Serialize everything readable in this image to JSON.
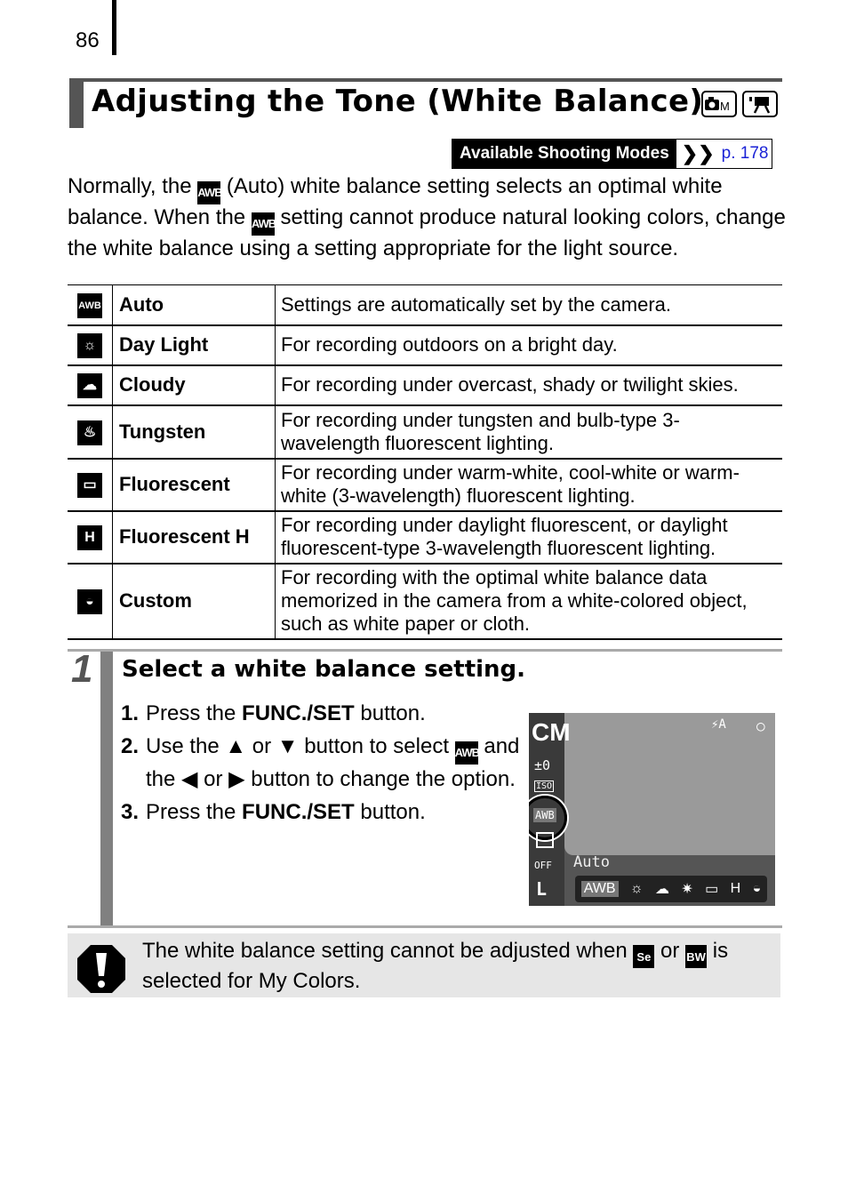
{
  "page_number": "86",
  "heading": {
    "title": "Adjusting the Tone (White Balance)",
    "mode_icons": [
      "camera-m-mode-icon",
      "movie-mode-icon"
    ],
    "mode_icon_text": "M"
  },
  "shooting_modes": {
    "label": "Available Shooting Modes",
    "link_chevron": "❯❯",
    "link_text": "p. 178"
  },
  "intro": {
    "part1": "Normally, the ",
    "icon_label": "AWB",
    "part2": " (Auto) white balance setting selects an optimal white balance. When the ",
    "part3": " setting cannot produce natural looking colors, change the white balance using a setting appropriate for the light source."
  },
  "settings_table": [
    {
      "icon": "awb-icon",
      "glyph": "AWB",
      "name": "Auto",
      "description": "Settings are automatically set by the camera."
    },
    {
      "icon": "daylight-icon",
      "glyph": "☼",
      "name": "Day Light",
      "description": "For recording outdoors on a bright day."
    },
    {
      "icon": "cloudy-icon",
      "glyph": "☁",
      "name": "Cloudy",
      "description": "For recording under overcast, shady or twilight skies."
    },
    {
      "icon": "tungsten-icon",
      "glyph": "♨",
      "name": "Tungsten",
      "description": "For recording under tungsten and bulb-type 3-wavelength fluorescent lighting."
    },
    {
      "icon": "fluorescent-icon",
      "glyph": "▭",
      "name": "Fluorescent",
      "description": "For recording under warm-white, cool-white or warm-white (3-wavelength) fluorescent lighting."
    },
    {
      "icon": "fluorescent-h-icon",
      "glyph": "H",
      "name": "Fluorescent H",
      "description": "For recording under daylight fluorescent, or daylight fluorescent-type 3-wavelength fluorescent lighting."
    },
    {
      "icon": "custom-icon",
      "glyph": "◒",
      "name": "Custom",
      "description": "For recording with the optimal white balance data memorized in the camera from a white-colored object, such as white paper or cloth."
    }
  ],
  "step": {
    "number": "1",
    "title": "Select a white balance setting.",
    "substeps": [
      {
        "n": "1.",
        "pre": "Press the ",
        "bold": "FUNC./SET",
        "post": " button."
      },
      {
        "n": "2.",
        "text_a": "Use the ▲ or ▼ button to select ",
        "icon": "AWB",
        "text_b": " and the ◀ or ▶ button to change the option."
      },
      {
        "n": "3.",
        "pre": "Press the ",
        "bold": "FUNC./SET",
        "post": " button."
      }
    ]
  },
  "camera_screen": {
    "mode": "CM",
    "exposure": "±0",
    "iso": "ISO",
    "wb_selected": "AWB",
    "flash": "⚡A",
    "setting_label": "Auto",
    "options": [
      "AWB",
      "☼",
      "☁",
      "✷",
      "▭",
      "H",
      "◒"
    ],
    "bottom_items": [
      "OFF",
      "L"
    ]
  },
  "note": {
    "text_a": "The white balance setting cannot be adjusted when ",
    "icon1": "Se",
    "text_or": " or ",
    "icon2": "BW",
    "text_b": " is selected for My Colors."
  }
}
